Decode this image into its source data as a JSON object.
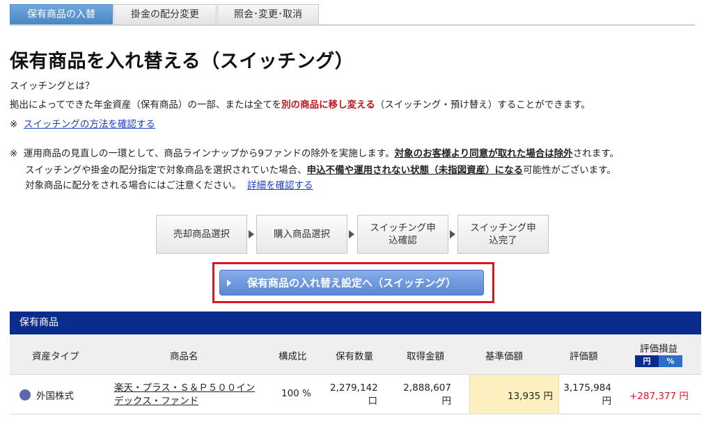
{
  "tabs": [
    {
      "label": "保有商品の入替",
      "active": true
    },
    {
      "label": "掛金の配分変更",
      "active": false
    },
    {
      "label": "照会･変更･取消",
      "active": false
    }
  ],
  "title": "保有商品を入れ替える（スイッチング）",
  "intro": {
    "question": "スイッチングとは？",
    "desc_pre": "拠出によってできた年金資産（保有商品）の一部、または全てを",
    "desc_red": "別の商品に移し変える",
    "desc_post": "（スイッチング・預け替え）することができます。",
    "note_mark": "※",
    "method_link": "スイッチングの方法を確認する"
  },
  "notice": {
    "mark": "※",
    "l1_pre": "運用商品の見直しの一環として、商品ラインナップから9ファンドの除外を実施します。",
    "l1_bold": "対象のお客様より同意が取れた場合は除外",
    "l1_post": "されます。",
    "l2_pre": "スイッチングや掛金の配分指定で対象商品を選択されていた場合、",
    "l2_bold": "申込不備や運用されない状態（未指図資産）になる",
    "l2_post": "可能性がございます。",
    "l3_pre": "対象商品に配分をされる場合にはご注意ください。",
    "l3_link": "詳細を確認する"
  },
  "steps": [
    {
      "label": "売却商品選択"
    },
    {
      "label": "購入商品選択"
    },
    {
      "label": "スイッチング申込確認"
    },
    {
      "label": "スイッチング申込完了"
    }
  ],
  "cta": {
    "label": "保有商品の入れ替え設定へ（スイッチング）"
  },
  "holdings": {
    "header": "保有商品",
    "columns": [
      "資産タイプ",
      "商品名",
      "構成比",
      "保有数量",
      "取得金額",
      "基準価額",
      "評価額",
      "評価損益"
    ],
    "toggle": {
      "yen": "円",
      "pct": "%"
    },
    "rows": [
      {
        "asset_type": "外国株式",
        "asset_color": "#5e66ad",
        "name": "楽天・プラス・Ｓ＆Ｐ５００インデックス・ファンド",
        "ratio": "100 %",
        "quantity": "2,279,142",
        "quantity_unit": "口",
        "cost": "2,888,607",
        "cost_unit": "円",
        "base_price": "13,935 円",
        "valuation": "3,175,984",
        "valuation_unit": "円",
        "pnl": "+287,377 円"
      }
    ]
  }
}
